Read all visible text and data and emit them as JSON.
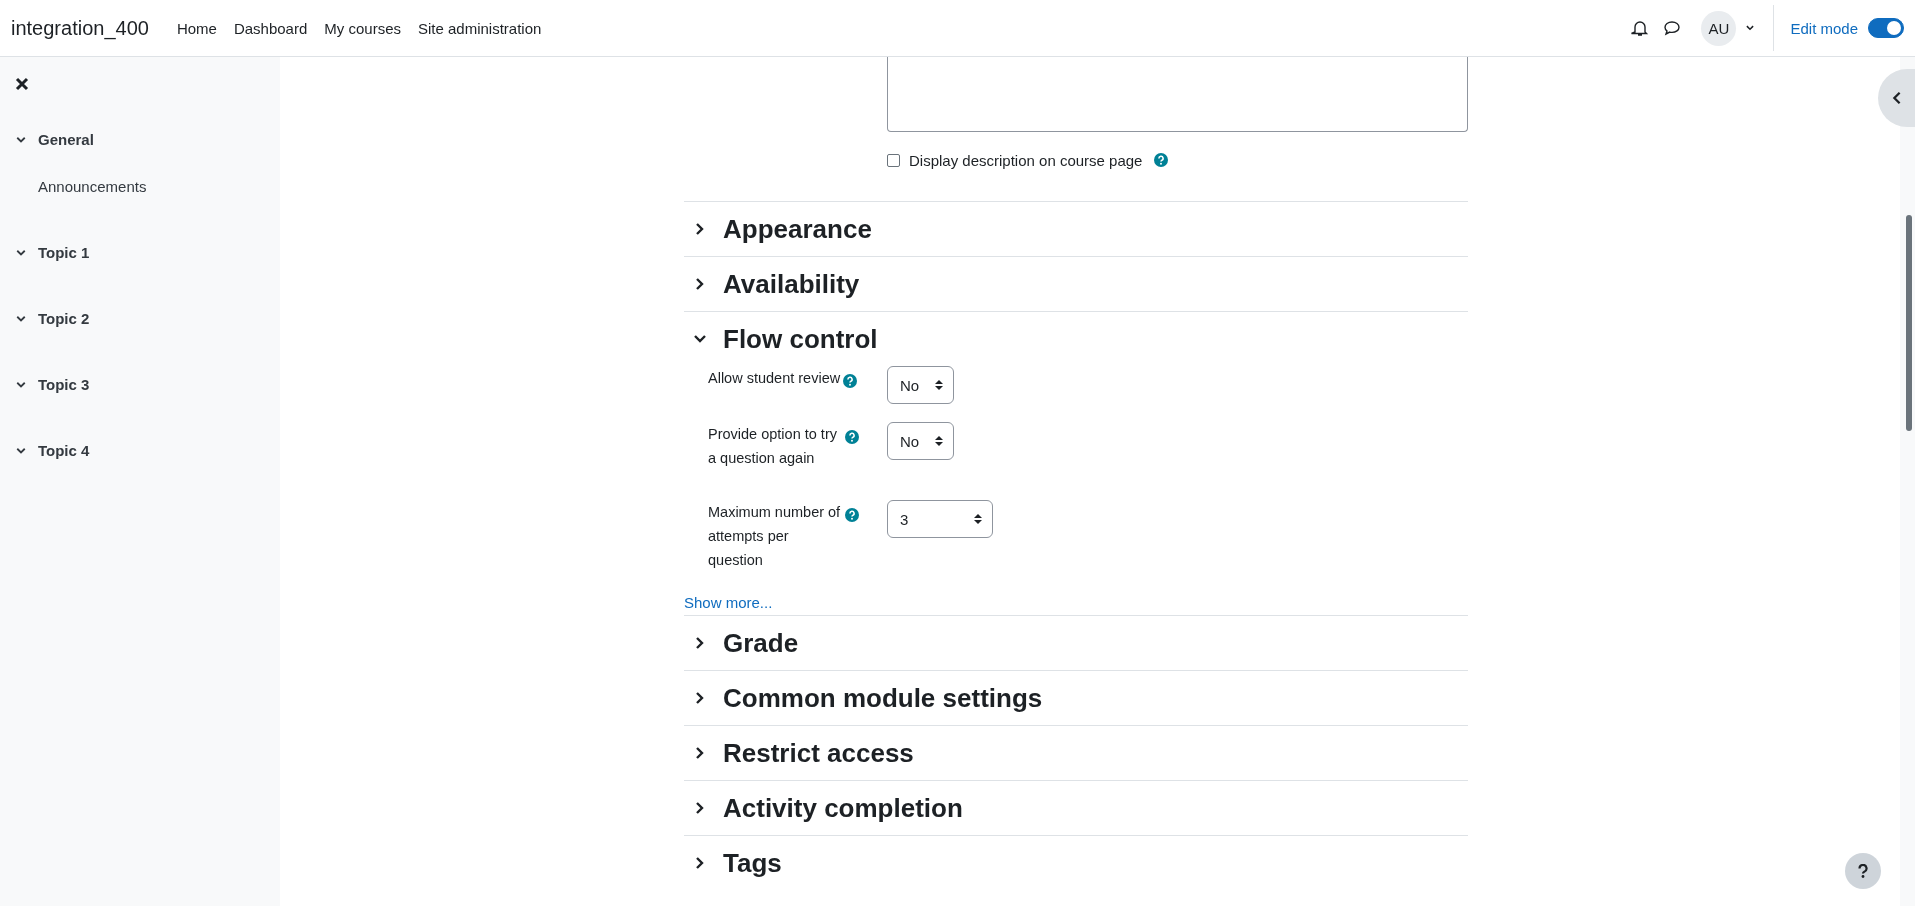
{
  "navbar": {
    "brand": "integration_400",
    "links": [
      "Home",
      "Dashboard",
      "My courses",
      "Site administration"
    ],
    "avatar": "AU",
    "edit_mode": {
      "label": "Edit mode",
      "on": true
    }
  },
  "sidebar": {
    "sections": [
      {
        "title": "General",
        "expanded": true,
        "items": [
          "Announcements"
        ]
      },
      {
        "title": "Topic 1",
        "expanded": true
      },
      {
        "title": "Topic 2",
        "expanded": true
      },
      {
        "title": "Topic 3",
        "expanded": true
      },
      {
        "title": "Topic 4",
        "expanded": true
      }
    ]
  },
  "description_option": {
    "label": "Display description on course page",
    "checked": false
  },
  "sections": [
    {
      "title": "Appearance",
      "expanded": false
    },
    {
      "title": "Availability",
      "expanded": false
    },
    {
      "title": "Flow control",
      "expanded": true,
      "fields": [
        {
          "label": "Allow student review",
          "value": "No",
          "kind": "short"
        },
        {
          "label": "Provide option to try a question again",
          "value": "No",
          "kind": "short"
        },
        {
          "label": "Maximum number of attempts per question",
          "value": "3",
          "kind": "wide"
        }
      ],
      "show_more": "Show more..."
    },
    {
      "title": "Grade",
      "expanded": false
    },
    {
      "title": "Common module settings",
      "expanded": false
    },
    {
      "title": "Restrict access",
      "expanded": false
    },
    {
      "title": "Activity completion",
      "expanded": false
    },
    {
      "title": "Tags",
      "expanded": false
    }
  ]
}
